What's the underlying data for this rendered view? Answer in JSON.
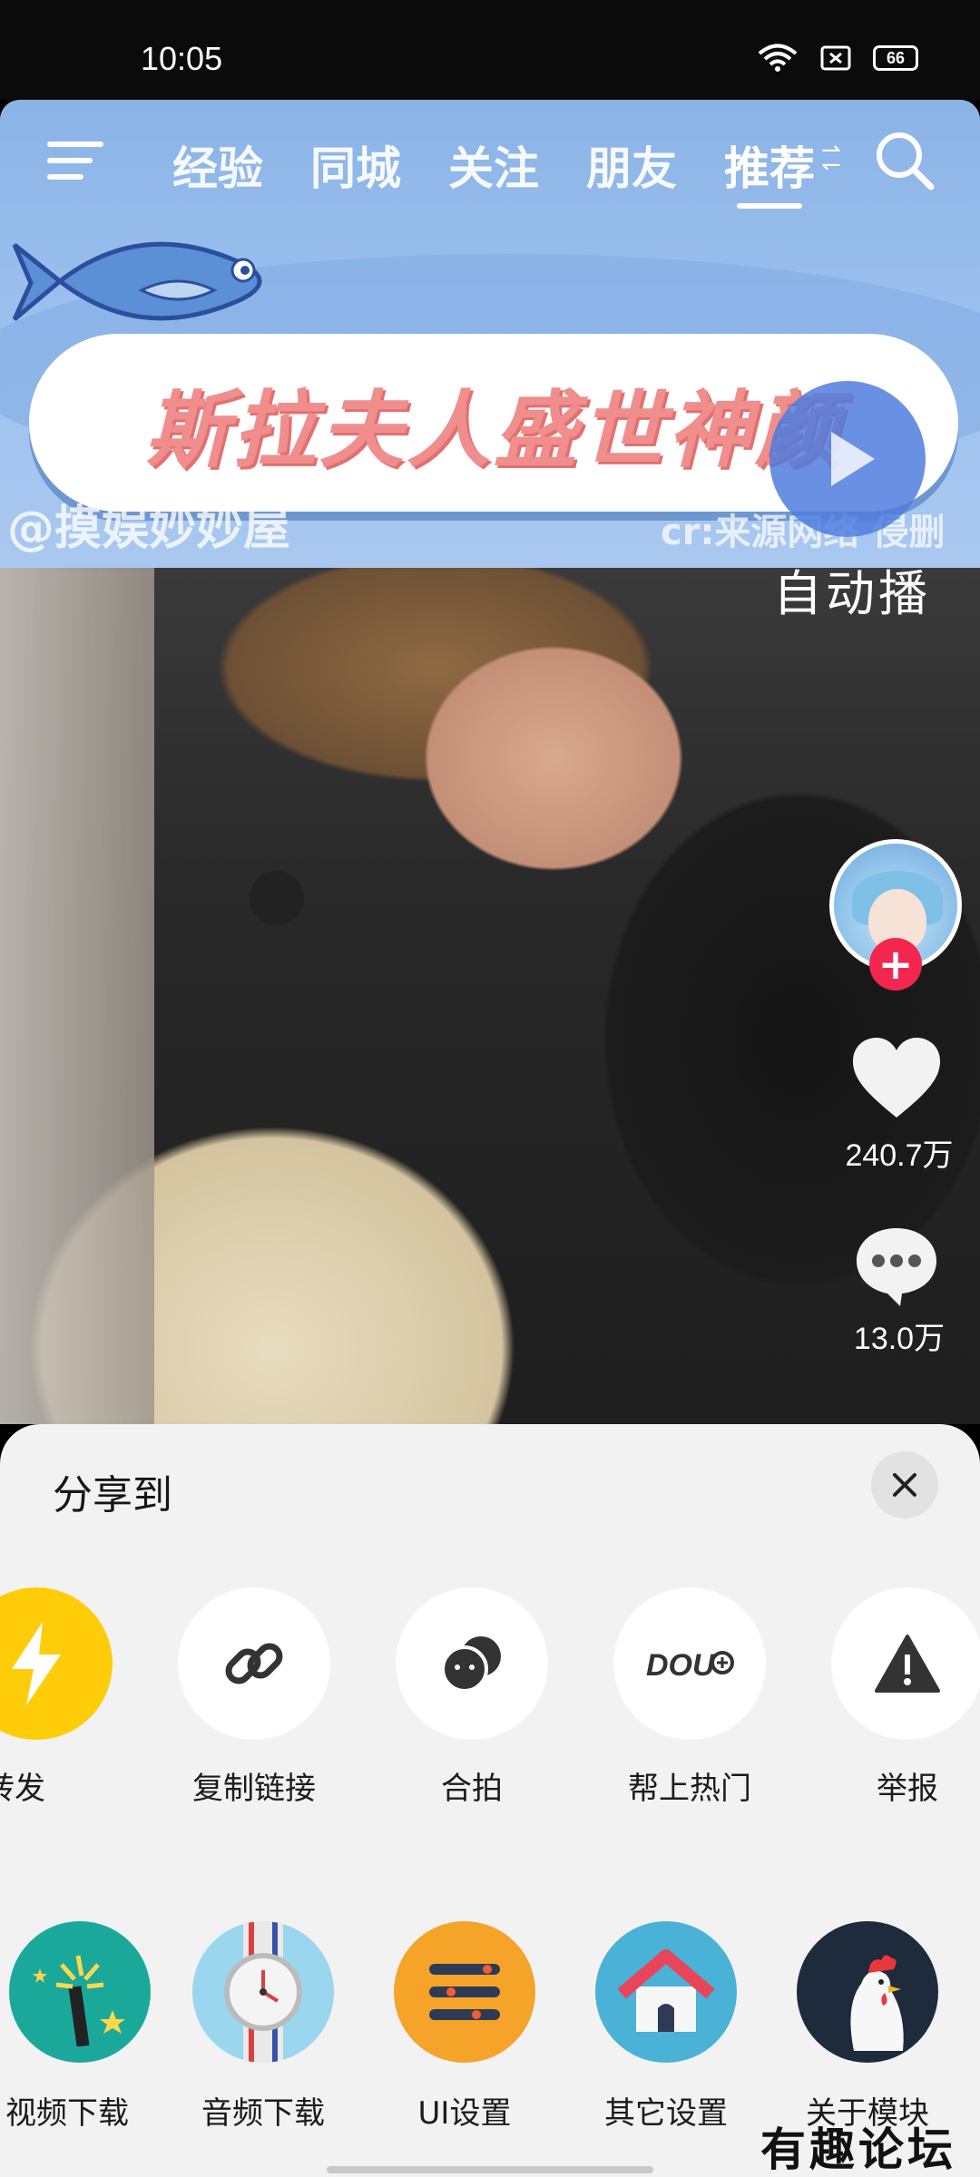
{
  "status_bar": {
    "time": "10:05",
    "battery": "66",
    "icons": [
      "wifi-icon",
      "sim-off-icon",
      "battery-icon"
    ]
  },
  "nav": {
    "tabs": [
      "经验",
      "同城",
      "关注",
      "朋友",
      "推荐"
    ],
    "active_tab": "推荐"
  },
  "video": {
    "banner_text": "斯拉夫人盛世神颜",
    "watermark_left": "@摸娱妙妙屋",
    "watermark_right": "cr:来源网络 侵删",
    "autoplay_label": "自动播"
  },
  "rail": {
    "like_count": "240.7万",
    "comment_count": "13.0万"
  },
  "share_sheet": {
    "title": "分享到",
    "row1": [
      {
        "label": "转发",
        "icon": "lightning-icon"
      },
      {
        "label": "复制链接",
        "icon": "link-icon"
      },
      {
        "label": "合拍",
        "icon": "duet-icon"
      },
      {
        "label": "帮上热门",
        "icon": "dou-plus-icon"
      },
      {
        "label": "举报",
        "icon": "warning-icon"
      }
    ],
    "row2": [
      {
        "label": "视频下载",
        "icon": "magic-wand-icon"
      },
      {
        "label": "音频下载",
        "icon": "watch-icon"
      },
      {
        "label": "UI设置",
        "icon": "list-icon"
      },
      {
        "label": "其它设置",
        "icon": "house-icon"
      },
      {
        "label": "关于模块",
        "icon": "rooster-icon"
      }
    ]
  },
  "site_watermark": "有趣论坛",
  "colors": {
    "accent_red": "#f2264f",
    "lightning_yellow": "#ffcc0a",
    "sheet_bg": "#f2f2f2"
  }
}
